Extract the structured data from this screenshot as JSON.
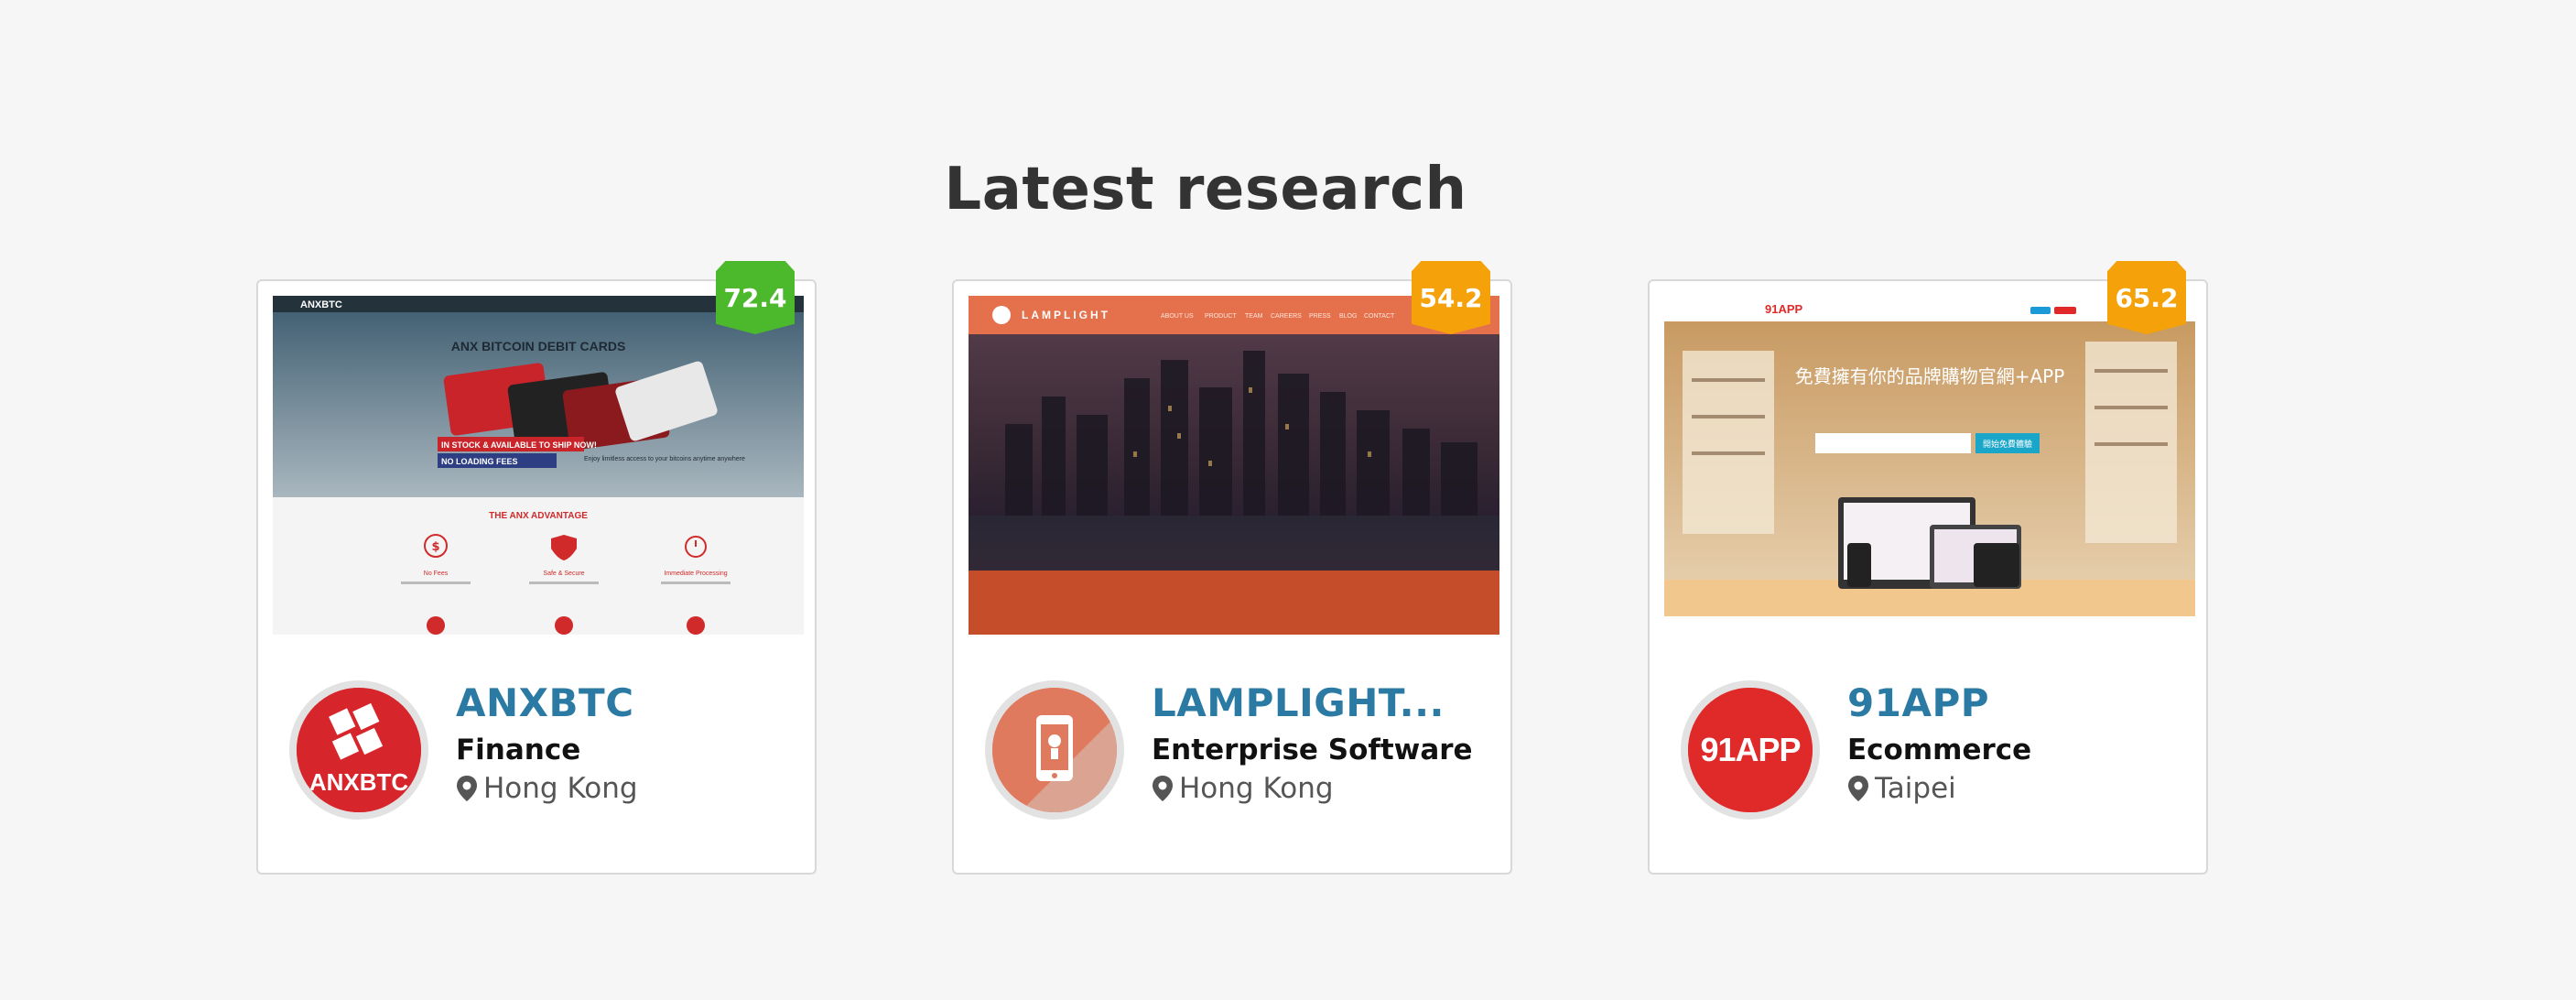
{
  "section": {
    "title": "Latest research"
  },
  "cards": [
    {
      "score": "72.4",
      "score_color": "#4cb82c",
      "name": "ANXBTC",
      "category": "Finance",
      "location": "Hong Kong",
      "logo": {
        "icon": "anxbtc-logo",
        "text": "ANXBTC",
        "bg": "#d6262c"
      },
      "screenshot": {
        "heading": "ANX BITCOIN DEBIT CARDS",
        "ribbon1": "IN STOCK & AVAILABLE TO SHIP NOW!",
        "ribbon2": "NO LOADING FEES",
        "caption": "Enjoy limitless access to your bitcoins anytime anywhere",
        "advantage": "THE ANX ADVANTAGE",
        "features": [
          "No Fees",
          "Safe & Secure",
          "Immediate Processing"
        ]
      }
    },
    {
      "score": "54.2",
      "score_color": "#f5a20a",
      "name": "LAMPLIGHT...",
      "category": "Enterprise Software",
      "location": "Hong Kong",
      "logo": {
        "icon": "phone-logo",
        "text": "",
        "bg": "#e07a5f"
      },
      "screenshot": {
        "brand": "LAMPLIGHT",
        "nav": [
          "ABOUT US",
          "PRODUCT",
          "TEAM",
          "CAREERS",
          "PRESS",
          "BLOG",
          "CONTACT"
        ]
      }
    },
    {
      "score": "65.2",
      "score_color": "#f5a20a",
      "name": "91APP",
      "category": "Ecommerce",
      "location": "Taipei",
      "logo": {
        "icon": "91app-logo",
        "text": "91APP",
        "bg": "#e02a2a"
      },
      "screenshot": {
        "brand": "91APP",
        "headline": "免費擁有你的品牌購物官網+APP",
        "button": "開始免費體驗"
      }
    }
  ]
}
